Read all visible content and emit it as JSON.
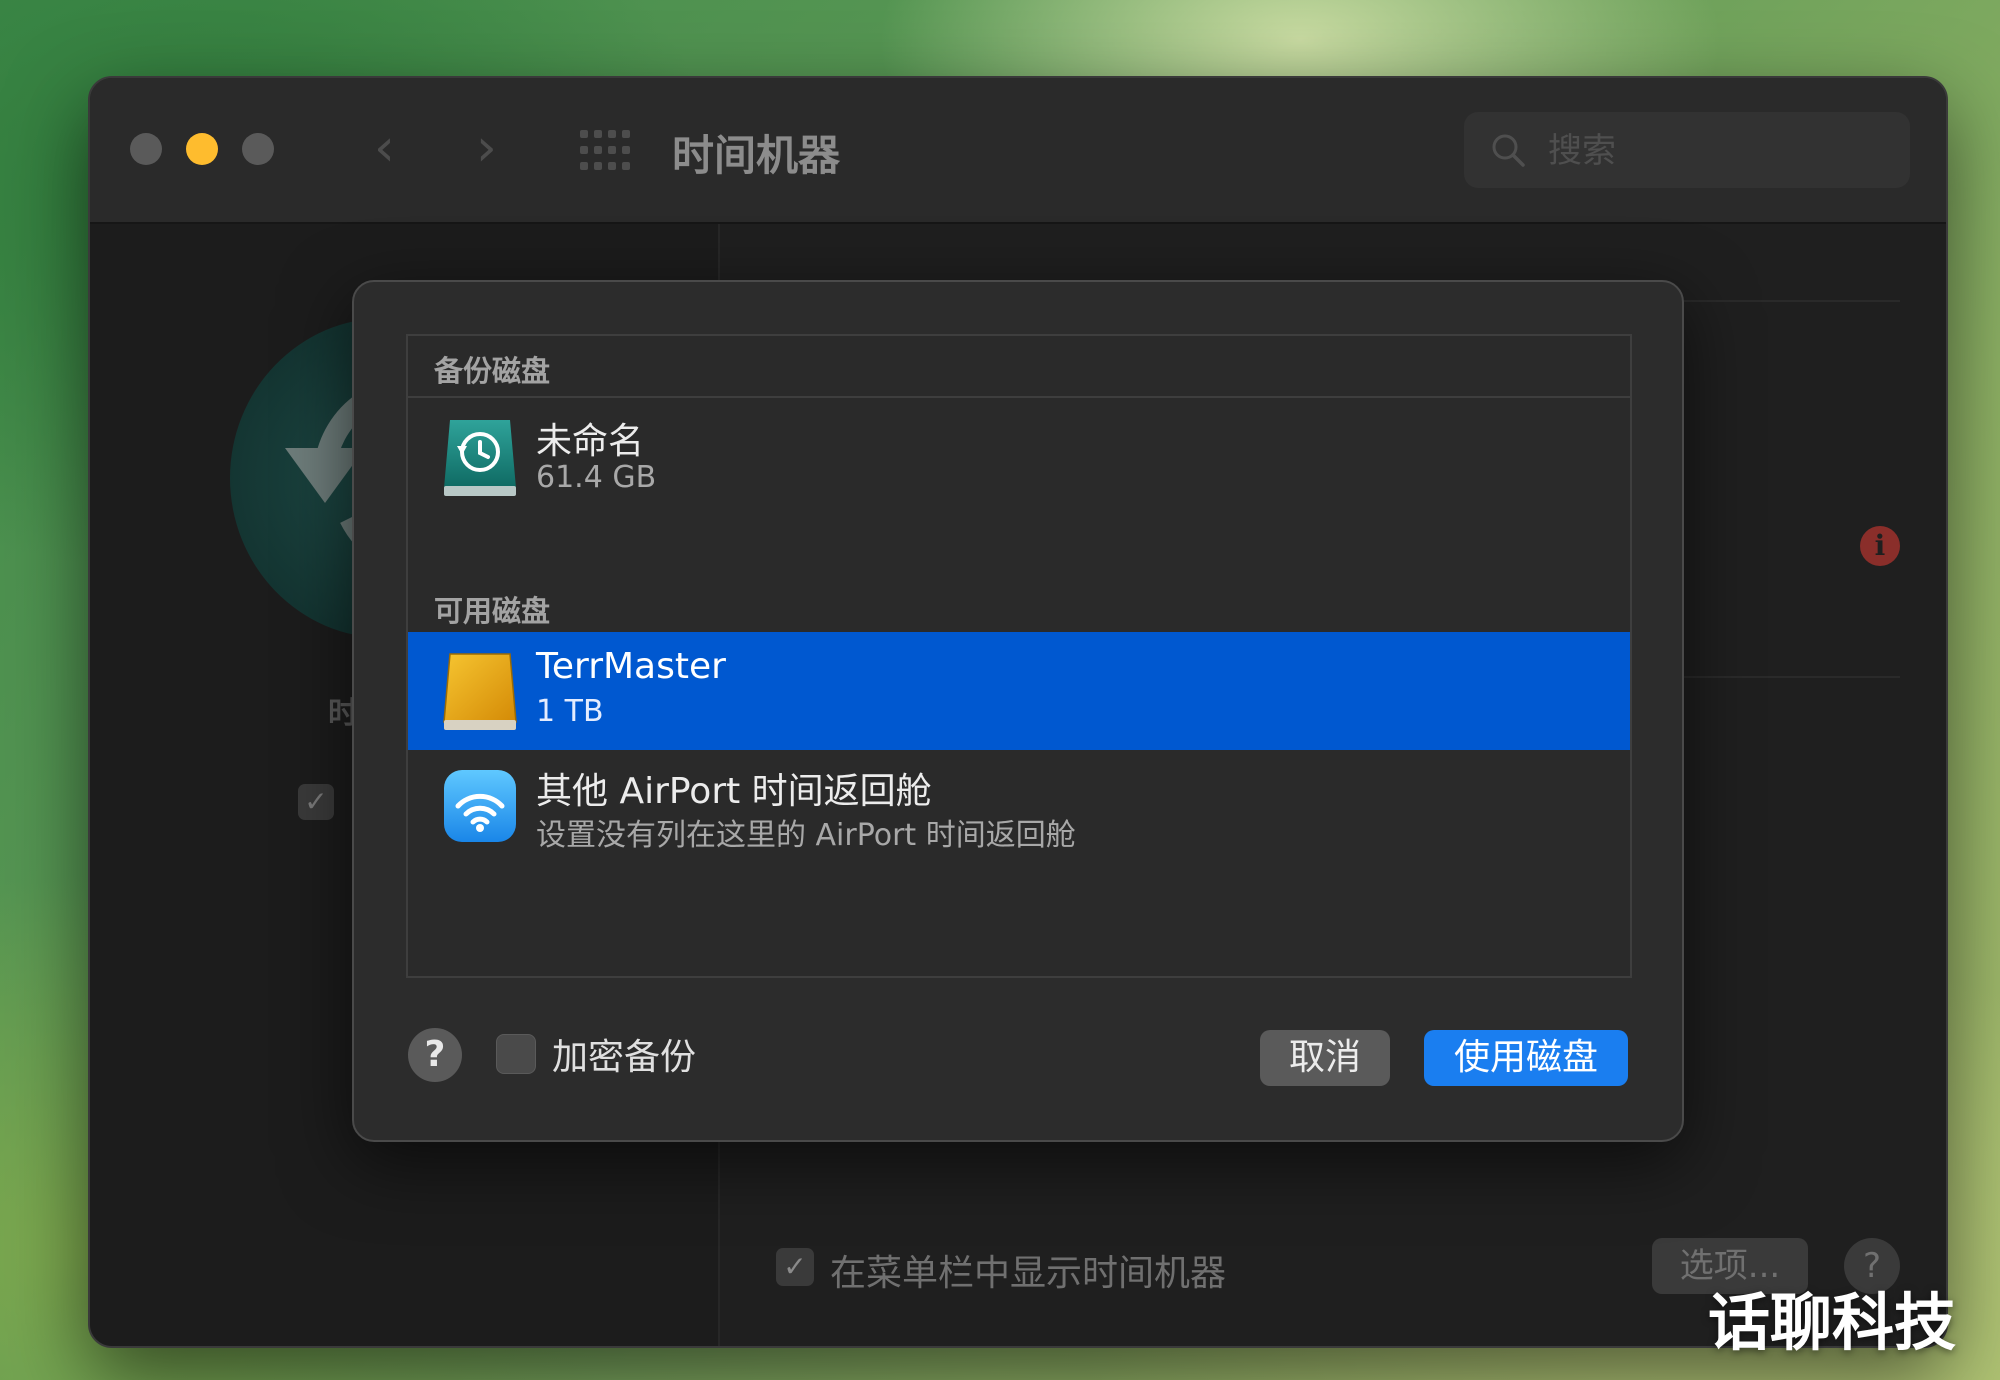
{
  "window": {
    "title": "时间机器",
    "search_placeholder": "搜索",
    "traffic_colors": {
      "close": "#5a5a5a",
      "minimize": "#febc2e",
      "zoom": "#5a5a5a"
    }
  },
  "background": {
    "sidebar_partial_label": "时",
    "menu_bar_checkbox_label": "在菜单栏中显示时间机器",
    "options_label": "选项...",
    "help_label": "?"
  },
  "dialog": {
    "backup_section": "备份磁盘",
    "backup_disks": [
      {
        "name": "未命名",
        "size": "61.4 GB",
        "icon": "time-machine-disk-icon"
      }
    ],
    "available_section": "可用磁盘",
    "available_disks": [
      {
        "name": "TerrMaster",
        "size": "1 TB",
        "icon": "external-drive-icon",
        "selected": true
      },
      {
        "name": "其他 AirPort 时间返回舱",
        "size": "设置没有列在这里的 AirPort 时间返回舱",
        "icon": "airport-wifi-icon",
        "selected": false
      }
    ],
    "help_label": "?",
    "encrypt_label": "加密备份",
    "encrypt_checked": false,
    "cancel_label": "取消",
    "use_disk_label": "使用磁盘",
    "accent_color": "#1a7ef0",
    "selection_color": "#0058d0"
  },
  "watermark": "话聊科技"
}
